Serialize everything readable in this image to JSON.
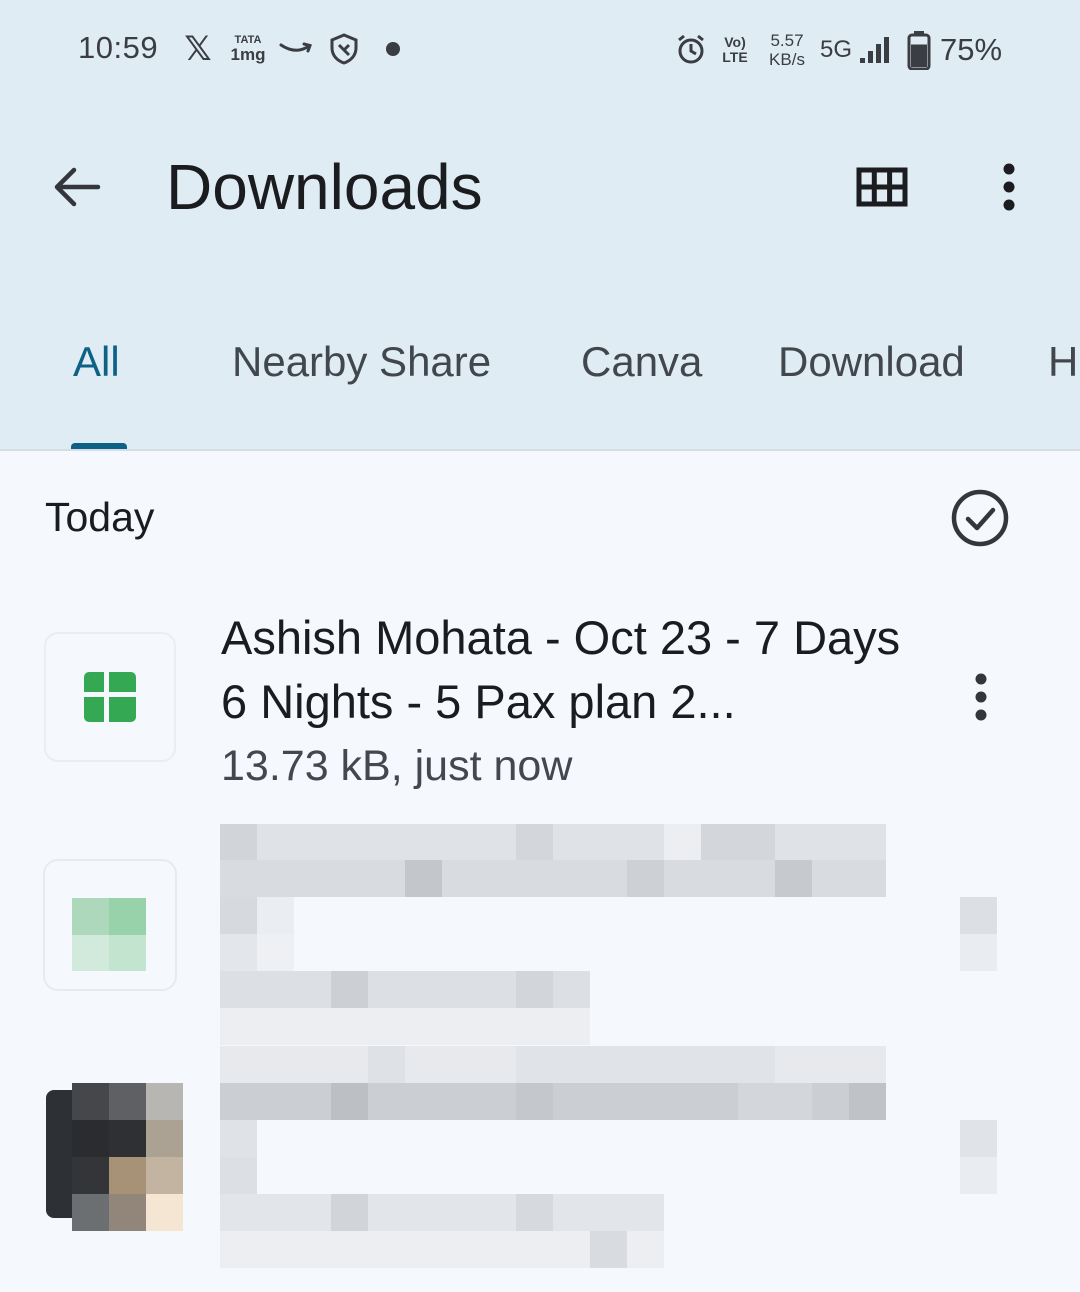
{
  "status_bar": {
    "time": "10:59",
    "x_glyph": "𝕏",
    "tata_top": "TATA",
    "tata_bottom": "1mg",
    "volte_top": "Vo)",
    "volte_bottom": "LTE",
    "speed_value": "5.57",
    "speed_unit": "KB/s",
    "network": "5G",
    "battery_percent": "75%",
    "battery_level": 0.75,
    "icons": [
      "x-icon",
      "tata-1mg-icon",
      "amazon-icon",
      "shield-icon",
      "dot-icon",
      "alarm-icon",
      "signal-icon",
      "battery-icon"
    ]
  },
  "app_bar": {
    "title": "Downloads",
    "icons": [
      "back-arrow-icon",
      "grid-view-icon",
      "more-vert-icon"
    ]
  },
  "tabs": [
    {
      "label": "All",
      "active": true
    },
    {
      "label": "Nearby Share",
      "active": false
    },
    {
      "label": "Canva",
      "active": false
    },
    {
      "label": "Download",
      "active": false
    },
    {
      "label": "H",
      "active": false
    }
  ],
  "section": {
    "title": "Today",
    "select_icon": "check-circle-icon"
  },
  "files": [
    {
      "name": "Ashish Mohata - Oct 23 -  7 Days 6 Nights - 5 Pax plan 2...",
      "meta": "13.73 kB, just now",
      "icon": "spreadsheet-icon",
      "icon_color": "#34a853"
    }
  ],
  "colors": {
    "header_bg": "#e0ecf4",
    "body_bg": "#f5f8fc",
    "accent": "#0d6184"
  }
}
